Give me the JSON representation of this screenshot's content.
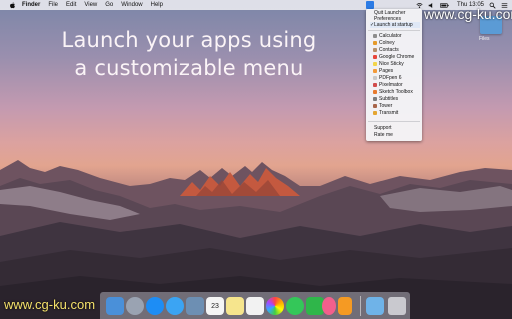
{
  "menubar": {
    "apple_icon": "apple-icon",
    "app_name": "Finder",
    "items": [
      "File",
      "Edit",
      "View",
      "Go",
      "Window",
      "Help"
    ],
    "clock": "Thu 13:05"
  },
  "headline": {
    "line1": "Launch your apps using",
    "line2": "a customizable menu"
  },
  "launcher_menu": {
    "top_items": [
      {
        "label": "Quit Launcher",
        "checked": false
      },
      {
        "label": "Preferences",
        "checked": false
      },
      {
        "label": "Launch at startup",
        "checked": true
      }
    ],
    "apps": [
      {
        "label": "Calculator",
        "icon": "calculator-icon",
        "color": "#8d8d8d"
      },
      {
        "label": "Colney",
        "icon": "colney-icon",
        "color": "#e59a2b"
      },
      {
        "label": "Contacts",
        "icon": "contacts-icon",
        "color": "#b7906a"
      },
      {
        "label": "Google Chrome",
        "icon": "chrome-icon",
        "color": "#e8463b"
      },
      {
        "label": "Nice Sticky",
        "icon": "sticky-icon",
        "color": "#f2d54a"
      },
      {
        "label": "Pages",
        "icon": "pages-icon",
        "color": "#f29a39"
      },
      {
        "label": "PDFpen 6",
        "icon": "pdfpen-icon",
        "color": "#c9c9c9"
      },
      {
        "label": "Pixelmator",
        "icon": "pixelmator-icon",
        "color": "#d14c4c"
      },
      {
        "label": "Sketch Toolbox",
        "icon": "sketch-toolbox-icon",
        "color": "#e77a2e"
      },
      {
        "label": "Subtitles",
        "icon": "subtitles-icon",
        "color": "#7c7c7c"
      },
      {
        "label": "Tower",
        "icon": "tower-icon",
        "color": "#a8654a"
      },
      {
        "label": "Transmit",
        "icon": "transmit-icon",
        "color": "#e4a531"
      }
    ],
    "bottom_items": [
      {
        "label": "Support"
      },
      {
        "label": "Rate me"
      }
    ]
  },
  "desktop": {
    "files_label": "Files"
  },
  "watermark": {
    "top": "www.cg-ku.com",
    "bottom": "www.cg-ku.com"
  },
  "dock": {
    "icons": [
      {
        "name": "finder-icon",
        "color": "#4a90d9"
      },
      {
        "name": "launchpad-icon",
        "color": "#9aa3b2"
      },
      {
        "name": "app-store-icon",
        "color": "#1d8df5"
      },
      {
        "name": "safari-icon",
        "color": "#3ba4f3"
      },
      {
        "name": "preview-icon",
        "color": "#6d8fb3"
      },
      {
        "name": "calendar-icon",
        "color": "#f5f5f5"
      },
      {
        "name": "notes-icon",
        "color": "#f6e58d"
      },
      {
        "name": "reminders-icon",
        "color": "#f2f2f2"
      },
      {
        "name": "photos-icon",
        "color": "#f0f0f0"
      },
      {
        "name": "messages-icon",
        "color": "#34c759"
      },
      {
        "name": "facetime-icon",
        "color": "#2fb64a"
      },
      {
        "name": "itunes-icon",
        "color": "#f25f8c"
      },
      {
        "name": "ibooks-icon",
        "color": "#f59a23"
      },
      {
        "name": "system-preferences-icon",
        "color": "#8e8e93"
      },
      {
        "name": "downloads-folder-icon",
        "color": "#6fb3e8"
      },
      {
        "name": "trash-icon",
        "color": "#c9c9cf"
      }
    ],
    "calendar_day": "23"
  }
}
